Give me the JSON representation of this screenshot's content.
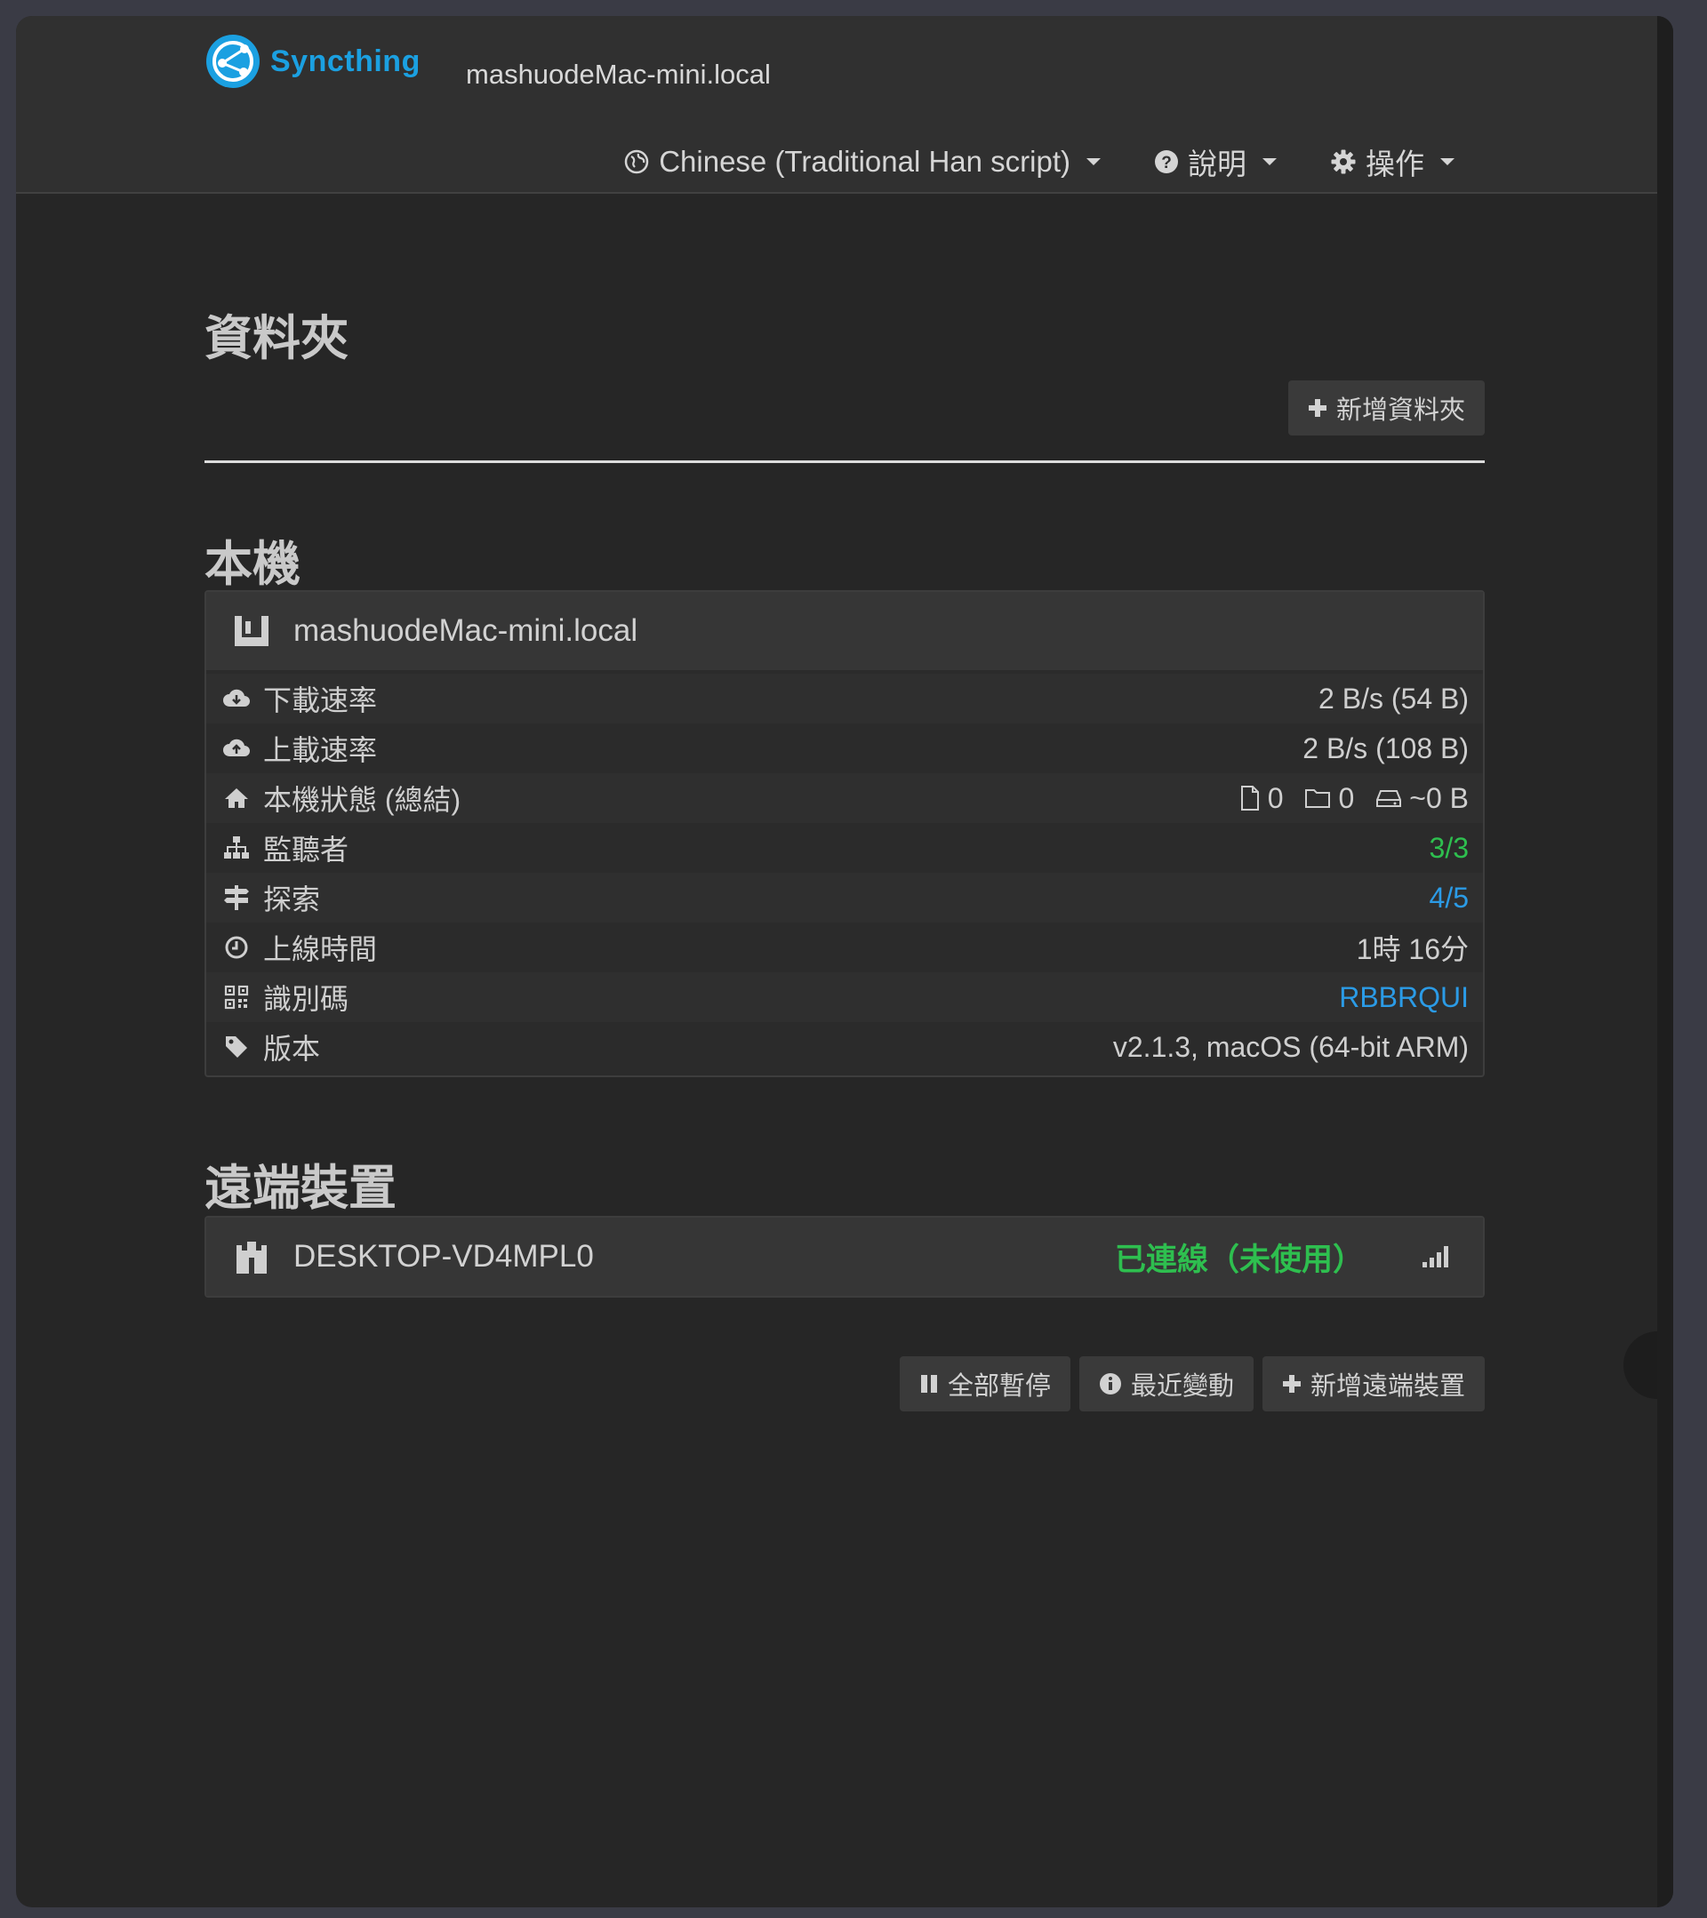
{
  "navbar": {
    "brand": "Syncthing",
    "host": "mashuodeMac-mini.local",
    "menu": {
      "language": "Chinese (Traditional Han script)",
      "help": "說明",
      "actions": "操作"
    }
  },
  "folders": {
    "heading": "資料夾",
    "add_button": "新增資料夾"
  },
  "this_device": {
    "heading": "本機",
    "name": "mashuodeMac-mini.local",
    "rows": [
      {
        "label": "下載速率",
        "value": "2 B/s (54 B)",
        "icon": "cloud-download-icon"
      },
      {
        "label": "上載速率",
        "value": "2 B/s (108 B)",
        "icon": "cloud-upload-icon"
      },
      {
        "label": "本機狀態 (總結)",
        "icon": "home-icon",
        "stats": {
          "files": "0",
          "folders": "0",
          "size": "~0 B"
        }
      },
      {
        "label": "監聽者",
        "value": "3/3",
        "icon": "sitemap-icon"
      },
      {
        "label": "探索",
        "value": "4/5",
        "icon": "signpost-icon"
      },
      {
        "label": "上線時間",
        "value": "1時 16分",
        "icon": "clock-icon"
      },
      {
        "label": "識別碼",
        "value": "RBBRQUI",
        "icon": "qrcode-icon"
      },
      {
        "label": "版本",
        "value": "v2.1.3, macOS (64-bit ARM)",
        "icon": "tag-icon"
      }
    ]
  },
  "remote_devices": {
    "heading": "遠端裝置",
    "devices": [
      {
        "name": "DESKTOP-VD4MPL0",
        "status": "已連線（未使用）"
      }
    ],
    "buttons": {
      "pause_all": "全部暫停",
      "recent_changes": "最近變動",
      "add_device": "新增遠端裝置"
    }
  },
  "colors": {
    "brand": "#1ba0e1",
    "green": "#2ebf4f",
    "blue": "#2b9be6",
    "background": "#262626"
  }
}
